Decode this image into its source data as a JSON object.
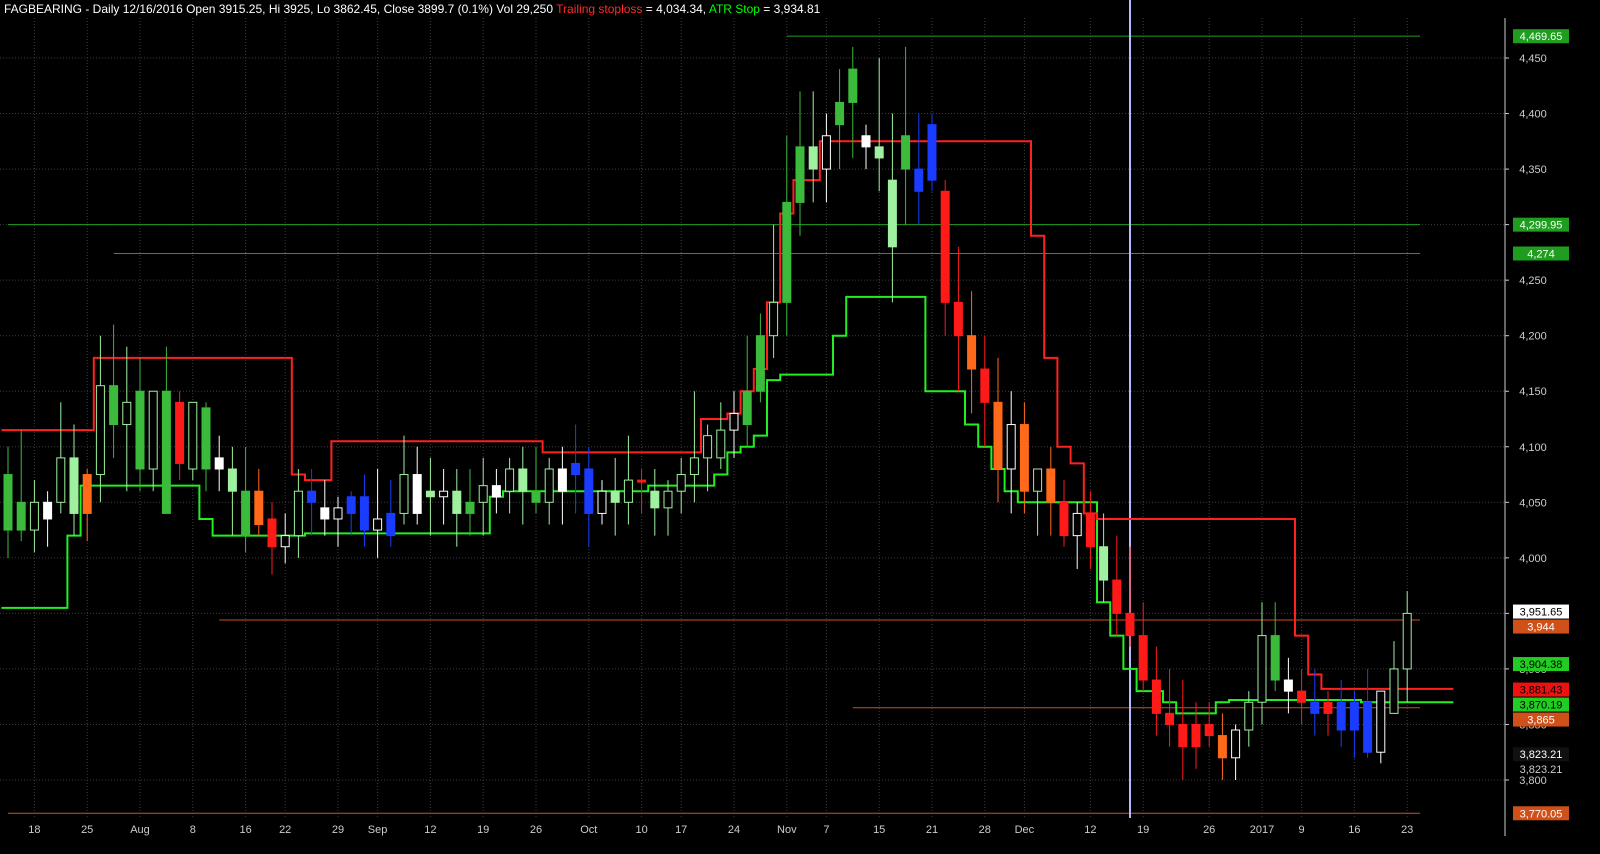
{
  "header": {
    "symbol_info": "FAGBEARING - Daily 12/16/2016 Open 3915.25, Hi 3925, Lo 3862.45, Close 3899.7 (0.1%) Vol 29,250",
    "trailing_label": "Trailing stoploss",
    "trailing_value": " = 4,034.34, ",
    "atr_label": "ATR Stop",
    "atr_value": " = 3,934.81"
  },
  "colors": {
    "background": "#000000",
    "grid": "#3c3c3c",
    "axis_text": "#cccccc",
    "trailing_stop": "#ff2020",
    "atr_stop": "#22ee22",
    "level_green": "#1f9d1f",
    "level_orange": "#d0501a",
    "cursor": "#b8b8ff"
  },
  "chart_data": {
    "type": "candlestick",
    "ylim": [
      3765,
      4475
    ],
    "y_ticks": [
      3800,
      3850,
      3900,
      3950,
      4000,
      4050,
      4100,
      4150,
      4200,
      4250,
      4300,
      4350,
      4400,
      4450
    ],
    "y_tick_labels": [
      "3,800",
      "3,850",
      "3,900",
      "3,950",
      "4,000",
      "4,050",
      "4,100",
      "4,150",
      "4,200",
      "4,250",
      "4,300",
      "4,350",
      "4,400",
      "4,450"
    ],
    "x_labels": [
      {
        "i": 2,
        "label": "18"
      },
      {
        "i": 6,
        "label": "25"
      },
      {
        "i": 10,
        "label": "Aug"
      },
      {
        "i": 14,
        "label": "8"
      },
      {
        "i": 18,
        "label": "16"
      },
      {
        "i": 21,
        "label": "22"
      },
      {
        "i": 25,
        "label": "29"
      },
      {
        "i": 28,
        "label": "Sep"
      },
      {
        "i": 32,
        "label": "12"
      },
      {
        "i": 36,
        "label": "19"
      },
      {
        "i": 40,
        "label": "26"
      },
      {
        "i": 44,
        "label": "Oct"
      },
      {
        "i": 48,
        "label": "10"
      },
      {
        "i": 51,
        "label": "17"
      },
      {
        "i": 55,
        "label": "24"
      },
      {
        "i": 59,
        "label": "Nov"
      },
      {
        "i": 62,
        "label": "7"
      },
      {
        "i": 66,
        "label": "15"
      },
      {
        "i": 70,
        "label": "21"
      },
      {
        "i": 74,
        "label": "28"
      },
      {
        "i": 77,
        "label": "Dec"
      },
      {
        "i": 82,
        "label": "12"
      },
      {
        "i": 86,
        "label": "19"
      },
      {
        "i": 91,
        "label": "26"
      },
      {
        "i": 95,
        "label": "2017"
      },
      {
        "i": 98,
        "label": "9"
      },
      {
        "i": 102,
        "label": "16"
      },
      {
        "i": 106,
        "label": "23"
      }
    ],
    "price_labels": [
      {
        "value": 4469.65,
        "text": "4,469.65",
        "bg": "#1f9d1f",
        "fg": "#ffffff"
      },
      {
        "value": 4299.95,
        "text": "4,299.95",
        "bg": "#1f9d1f",
        "fg": "#ffffff"
      },
      {
        "value": 4274,
        "text": "4,274",
        "bg": "#1f9d1f",
        "fg": "#ffffff"
      },
      {
        "value": 3951.65,
        "text": "3,951.65",
        "bg": "#ffffff",
        "fg": "#000000"
      },
      {
        "value": 3944,
        "text": "3,944",
        "bg": "#d0501a",
        "fg": "#ffffff"
      },
      {
        "value": 3904.38,
        "text": "3,904.38",
        "bg": "#22cc22",
        "fg": "#000000"
      },
      {
        "value": 3881.43,
        "text": "3,881.43",
        "bg": "#ee1111",
        "fg": "#000000"
      },
      {
        "value": 3870.19,
        "text": "3,870.19",
        "bg": "#22cc22",
        "fg": "#000000"
      },
      {
        "value": 3865,
        "text": "3,865",
        "bg": "#d0501a",
        "fg": "#ffffff"
      },
      {
        "value": 3823.21,
        "text": "3,823.21",
        "bg": "#111111",
        "fg": "#ffffff"
      },
      {
        "value": 3823.21,
        "text": "3,823.21",
        "bg": "#000000",
        "fg": "#cccccc"
      },
      {
        "value": 3770.05,
        "text": "3,770.05",
        "bg": "#d0501a",
        "fg": "#ffffff"
      }
    ],
    "levels": [
      {
        "value": 4469.65,
        "i_start": 59,
        "color": "green"
      },
      {
        "value": 4299.95,
        "i_start": 0,
        "color": "green"
      },
      {
        "value": 4274,
        "i_start": 8,
        "color": "green"
      },
      {
        "value": 3944,
        "i_start": 16,
        "color": "orange"
      },
      {
        "value": 3865,
        "i_start": 64,
        "color": "orange"
      },
      {
        "value": 3770.05,
        "i_start": 0,
        "color": "orange"
      }
    ],
    "cursor_index": 85,
    "series_candles": [
      [
        4075,
        4100,
        4000,
        4025,
        "green"
      ],
      [
        4050,
        4115,
        4015,
        4025,
        "green"
      ],
      [
        4025,
        4070,
        4005,
        4050,
        "light"
      ],
      [
        4050,
        4060,
        4010,
        4035,
        "white"
      ],
      [
        4050,
        4140,
        4040,
        4090,
        "light"
      ],
      [
        4090,
        4120,
        4020,
        4040,
        "light"
      ],
      [
        4040,
        4080,
        4015,
        4075,
        "orange"
      ],
      [
        4075,
        4200,
        4050,
        4155,
        "light"
      ],
      [
        4155,
        4210,
        4090,
        4120,
        "green"
      ],
      [
        4120,
        4190,
        4060,
        4140,
        "light"
      ],
      [
        4150,
        4180,
        4060,
        4080,
        "green"
      ],
      [
        4080,
        4140,
        4060,
        4150,
        "light"
      ],
      [
        4150,
        4190,
        4040,
        4040,
        "green"
      ],
      [
        4140,
        4150,
        4070,
        4085,
        "red"
      ],
      [
        4080,
        4120,
        4070,
        4140,
        "light"
      ],
      [
        4135,
        4140,
        4060,
        4080,
        "green"
      ],
      [
        4090,
        4110,
        4060,
        4080,
        "white"
      ],
      [
        4080,
        4100,
        4020,
        4060,
        "light"
      ],
      [
        4060,
        4100,
        4005,
        4020,
        "green"
      ],
      [
        4060,
        4080,
        4020,
        4030,
        "orange"
      ],
      [
        4035,
        4050,
        3985,
        4010,
        "red"
      ],
      [
        4010,
        4040,
        3995,
        4020,
        "white"
      ],
      [
        4020,
        4080,
        4000,
        4060,
        "light"
      ],
      [
        4060,
        4080,
        4020,
        4050,
        "blue"
      ],
      [
        4045,
        4070,
        4020,
        4035,
        "white"
      ],
      [
        4035,
        4055,
        4010,
        4045,
        "white"
      ],
      [
        4040,
        4060,
        4020,
        4055,
        "blue"
      ],
      [
        4055,
        4075,
        4010,
        4025,
        "blue"
      ],
      [
        4025,
        4080,
        4000,
        4035,
        "white"
      ],
      [
        4040,
        4070,
        4010,
        4020,
        "blue"
      ],
      [
        4040,
        4110,
        4030,
        4075,
        "light"
      ],
      [
        4075,
        4100,
        4030,
        4040,
        "white"
      ],
      [
        4060,
        4090,
        4020,
        4055,
        "light"
      ],
      [
        4055,
        4080,
        4030,
        4060,
        "white"
      ],
      [
        4060,
        4080,
        4010,
        4040,
        "light"
      ],
      [
        4040,
        4080,
        4020,
        4050,
        "green"
      ],
      [
        4050,
        4090,
        4020,
        4065,
        "light"
      ],
      [
        4065,
        4080,
        4040,
        4055,
        "white"
      ],
      [
        4060,
        4090,
        4040,
        4080,
        "light"
      ],
      [
        4080,
        4100,
        4030,
        4060,
        "light"
      ],
      [
        4060,
        4100,
        4040,
        4050,
        "green"
      ],
      [
        4050,
        4090,
        4030,
        4080,
        "light"
      ],
      [
        4080,
        4100,
        4030,
        4060,
        "white"
      ],
      [
        4075,
        4120,
        4040,
        4085,
        "blue"
      ],
      [
        4080,
        4100,
        4010,
        4040,
        "blue"
      ],
      [
        4040,
        4070,
        4030,
        4060,
        "white"
      ],
      [
        4060,
        4090,
        4020,
        4050,
        "light"
      ],
      [
        4050,
        4110,
        4030,
        4070,
        "light"
      ],
      [
        4070,
        4080,
        4040,
        4070,
        "red"
      ],
      [
        4060,
        4080,
        4020,
        4045,
        "light"
      ],
      [
        4045,
        4070,
        4020,
        4060,
        "light"
      ],
      [
        4060,
        4090,
        4040,
        4075,
        "light"
      ],
      [
        4075,
        4150,
        4050,
        4090,
        "light"
      ],
      [
        4090,
        4120,
        4060,
        4110,
        "light"
      ],
      [
        4090,
        4140,
        4080,
        4115,
        "light"
      ],
      [
        4115,
        4150,
        4090,
        4130,
        "white"
      ],
      [
        4120,
        4200,
        4100,
        4150,
        "green"
      ],
      [
        4150,
        4220,
        4140,
        4200,
        "green"
      ],
      [
        4200,
        4300,
        4180,
        4230,
        "light"
      ],
      [
        4230,
        4380,
        4200,
        4320,
        "green"
      ],
      [
        4320,
        4420,
        4290,
        4370,
        "green"
      ],
      [
        4370,
        4420,
        4320,
        4350,
        "light"
      ],
      [
        4350,
        4400,
        4320,
        4380,
        "white"
      ],
      [
        4390,
        4440,
        4350,
        4410,
        "green"
      ],
      [
        4410,
        4460,
        4360,
        4440,
        "green"
      ],
      [
        4380,
        4390,
        4350,
        4370,
        "white"
      ],
      [
        4370,
        4450,
        4330,
        4360,
        "light"
      ],
      [
        4340,
        4400,
        4230,
        4280,
        "light"
      ],
      [
        4380,
        4460,
        4300,
        4350,
        "green"
      ],
      [
        4350,
        4400,
        4300,
        4330,
        "blue"
      ],
      [
        4390,
        4400,
        4330,
        4340,
        "blue"
      ],
      [
        4330,
        4340,
        4200,
        4230,
        "red"
      ],
      [
        4230,
        4280,
        4150,
        4200,
        "red"
      ],
      [
        4200,
        4240,
        4130,
        4170,
        "orange"
      ],
      [
        4170,
        4200,
        4100,
        4140,
        "red"
      ],
      [
        4140,
        4180,
        4050,
        4080,
        "orange"
      ],
      [
        4080,
        4150,
        4040,
        4120,
        "white"
      ],
      [
        4120,
        4140,
        4040,
        4060,
        "orange"
      ],
      [
        4060,
        4080,
        4020,
        4080,
        "light"
      ],
      [
        4080,
        4100,
        4020,
        4050,
        "orange"
      ],
      [
        4050,
        4070,
        4010,
        4020,
        "red"
      ],
      [
        4020,
        4050,
        3990,
        4040,
        "white"
      ],
      [
        4040,
        4060,
        3990,
        4010,
        "red"
      ],
      [
        4010,
        4040,
        3960,
        3980,
        "light"
      ],
      [
        3980,
        4020,
        3930,
        3950,
        "red"
      ],
      [
        3950,
        4010,
        3920,
        3930,
        "red"
      ],
      [
        3930,
        3960,
        3880,
        3890,
        "red"
      ],
      [
        3890,
        3920,
        3840,
        3860,
        "red"
      ],
      [
        3860,
        3900,
        3830,
        3850,
        "red"
      ],
      [
        3850,
        3890,
        3800,
        3830,
        "red"
      ],
      [
        3830,
        3870,
        3810,
        3850,
        "red"
      ],
      [
        3850,
        3870,
        3830,
        3840,
        "red"
      ],
      [
        3840,
        3860,
        3800,
        3820,
        "orange"
      ],
      [
        3820,
        3850,
        3800,
        3845,
        "white"
      ],
      [
        3845,
        3880,
        3830,
        3870,
        "light"
      ],
      [
        3870,
        3960,
        3850,
        3930,
        "light"
      ],
      [
        3930,
        3960,
        3880,
        3890,
        "green"
      ],
      [
        3890,
        3910,
        3860,
        3880,
        "white"
      ],
      [
        3880,
        3900,
        3850,
        3870,
        "red"
      ],
      [
        3870,
        3900,
        3840,
        3860,
        "blue"
      ],
      [
        3860,
        3880,
        3840,
        3870,
        "red"
      ],
      [
        3870,
        3890,
        3830,
        3845,
        "blue"
      ],
      [
        3845,
        3880,
        3820,
        3870,
        "blue"
      ],
      [
        3870,
        3900,
        3820,
        3825,
        "blue"
      ],
      [
        3825,
        3860,
        3815,
        3880,
        "white"
      ],
      [
        3860,
        3925,
        3860,
        3900,
        "light"
      ],
      [
        3900,
        3970,
        3870,
        3950,
        "light"
      ]
    ],
    "trailing_stop_series": [
      4115,
      4115,
      4115,
      4115,
      4115,
      4115,
      4115,
      4180,
      4180,
      4180,
      4180,
      4180,
      4180,
      4180,
      4180,
      4180,
      4180,
      4180,
      4180,
      4180,
      4180,
      4180,
      4075,
      4070,
      4070,
      4105,
      4105,
      4105,
      4105,
      4105,
      4105,
      4105,
      4105,
      4105,
      4105,
      4105,
      4105,
      4105,
      4105,
      4105,
      4105,
      4095,
      4095,
      4095,
      4095,
      4095,
      4095,
      4095,
      4095,
      4095,
      4095,
      4095,
      4095,
      4125,
      4125,
      4130,
      4150,
      4170,
      4230,
      4310,
      4340,
      4340,
      4375,
      4375,
      4375,
      4375,
      4375,
      4375,
      4375,
      4375,
      4375,
      4375,
      4375,
      4375,
      4375,
      4375,
      4375,
      4375,
      4290,
      4180,
      4100,
      4085,
      4040,
      4035,
      4035,
      4035,
      4035,
      4035,
      4035,
      4035,
      4035,
      4035,
      4035,
      4035,
      4035,
      4035,
      4035,
      4035,
      3930,
      3895,
      3882,
      3882,
      3882,
      3882,
      3882,
      3882,
      3882,
      3882,
      3882,
      3882
    ],
    "atr_stop_series": [
      3955,
      3955,
      3955,
      3955,
      3955,
      4020,
      4065,
      4065,
      4065,
      4065,
      4065,
      4065,
      4065,
      4065,
      4065,
      4035,
      4020,
      4020,
      4020,
      4020,
      4020,
      4020,
      4020,
      4022,
      4022,
      4022,
      4022,
      4022,
      4022,
      4022,
      4022,
      4022,
      4022,
      4022,
      4022,
      4022,
      4022,
      4055,
      4060,
      4060,
      4060,
      4060,
      4060,
      4060,
      4060,
      4060,
      4060,
      4060,
      4060,
      4065,
      4065,
      4065,
      4065,
      4065,
      4075,
      4095,
      4100,
      4110,
      4160,
      4165,
      4165,
      4165,
      4165,
      4200,
      4235,
      4235,
      4235,
      4235,
      4235,
      4235,
      4150,
      4150,
      4150,
      4120,
      4100,
      4080,
      4060,
      4050,
      4050,
      4050,
      4050,
      4050,
      4050,
      3960,
      3930,
      3900,
      3880,
      3880,
      3870,
      3860,
      3860,
      3860,
      3870,
      3872,
      3872,
      3872,
      3872,
      3872,
      3872,
      3872,
      3872,
      3872,
      3872,
      3870,
      3870,
      3870,
      3870,
      3870,
      3870,
      3870
    ]
  }
}
